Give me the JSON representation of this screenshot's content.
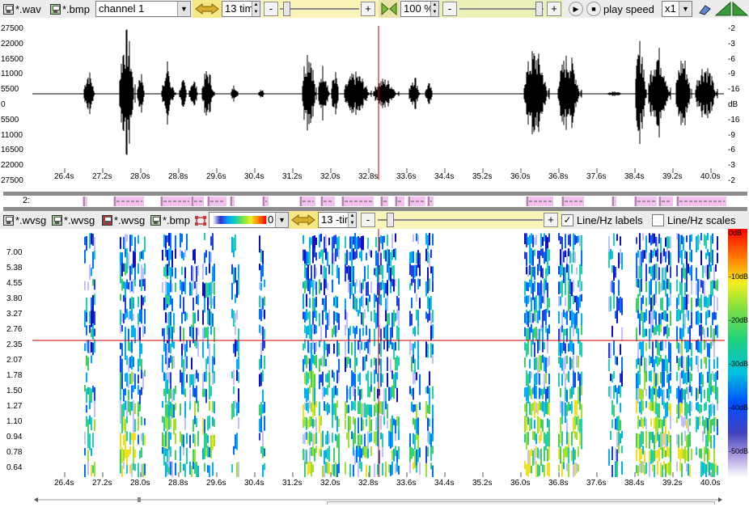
{
  "toolbar1": {
    "wav_label": "*.wav",
    "bmp_label": "*.bmp",
    "channel": "channel 1",
    "zoom_time": "13 tim",
    "percent": "100 %",
    "play_speed_label": "play speed",
    "speed_value": "x1",
    "minus": "-",
    "plus": "+"
  },
  "waveform": {
    "y_labels": [
      "27500",
      "22000",
      "16500",
      "11000",
      "5500",
      "0",
      "5500",
      "11000",
      "16500",
      "22000",
      "27500"
    ],
    "db_labels": [
      "-2",
      "-3",
      "-6",
      "-9",
      "-16",
      "dB",
      "-16",
      "-9",
      "-6",
      "-3",
      "-2"
    ],
    "x_labels": [
      "26.4s",
      "27.2s",
      "28.0s",
      "28.8s",
      "29.6s",
      "30.4s",
      "31.2s",
      "32.0s",
      "32.8s",
      "33.6s",
      "34.4s",
      "35.2s",
      "36.0s",
      "36.8s",
      "37.6s",
      "38.4s",
      "39.2s",
      "40.0s"
    ]
  },
  "segments": {
    "label": "2:"
  },
  "toolbar2": {
    "wvsg1": "*.wvsg",
    "wvsg2": "*.wvsg",
    "wvsg3": "*.wvsg",
    "bmp": "*.bmp",
    "colormap_value": "0",
    "zoom_time": "13 -tin",
    "line_hz_labels": "Line/Hz labels",
    "line_hz_scales": "Line/Hz scales",
    "line_hz_labels_checked": true,
    "line_hz_scales_checked": false,
    "check": "✓"
  },
  "spectrogram": {
    "y_labels": [
      "7.00",
      "5.38",
      "4.55",
      "3.80",
      "3.27",
      "2.76",
      "2.35",
      "2.07",
      "1.78",
      "1.50",
      "1.27",
      "1.10",
      "0.94",
      "0.78",
      "0.64"
    ],
    "db_labels": [
      "0dB",
      "-10dB",
      "-20dB",
      "-30dB",
      "-40dB",
      "-50dB"
    ],
    "x_labels": [
      "26.4s",
      "27.2s",
      "28.0s",
      "28.8s",
      "29.6s",
      "30.4s",
      "31.2s",
      "32.0s",
      "32.8s",
      "33.6s",
      "34.4s",
      "35.2s",
      "36.0s",
      "36.8s",
      "37.6s",
      "38.4s",
      "39.2s",
      "40.0s"
    ]
  },
  "colors": {
    "cursor": "#cc0000",
    "waveform": "#000000",
    "segment": "#f4c0f0",
    "toolbar_yellow": "#f6e788"
  }
}
